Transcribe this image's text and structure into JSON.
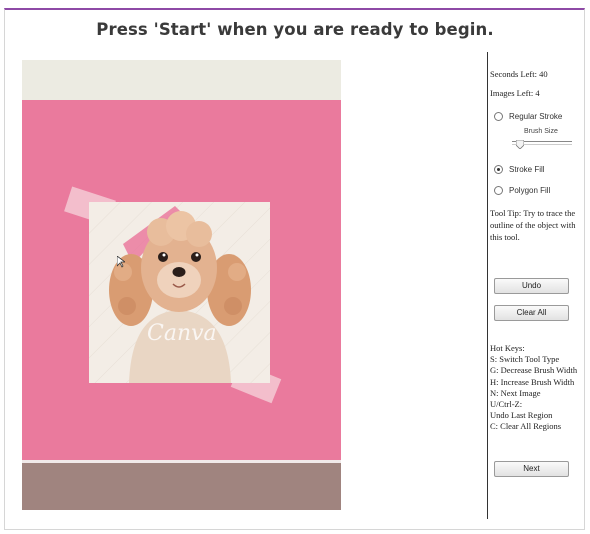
{
  "header": {
    "title": "Press 'Start' when you are ready to begin."
  },
  "status": {
    "seconds_left": "Seconds Left: 40",
    "images_left": "Images Left: 4"
  },
  "tools": {
    "regular_stroke": "Regular Stroke",
    "brush_size_label": "Brush Size",
    "stroke_fill": "Stroke Fill",
    "polygon_fill": "Polygon Fill",
    "selected": "stroke_fill"
  },
  "tooltip": "Tool Tip: Try to trace the outline of the object with this tool.",
  "buttons": {
    "undo": "Undo",
    "clear_all": "Clear All",
    "next": "Next"
  },
  "hotkeys": [
    "Hot Keys:",
    "S: Switch Tool Type",
    "G: Decrease Brush Width",
    "H: Increase Brush Width",
    "N: Next Image",
    "U/Ctrl-Z:",
    "Undo Last Region",
    "C: Clear All Regions"
  ],
  "image": {
    "watermark": "Canva"
  },
  "colors": {
    "accent": "#8e4aa6",
    "pink_background": "#ea7a9d",
    "top_band": "#ecebe2",
    "bottom_band": "#a0847f"
  }
}
